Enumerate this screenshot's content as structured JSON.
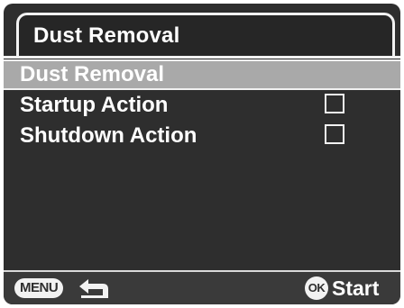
{
  "header": {
    "title": "Dust Removal"
  },
  "menu": {
    "items": [
      {
        "label": "Dust Removal",
        "selected": true,
        "has_checkbox": false
      },
      {
        "label": "Startup Action",
        "selected": false,
        "has_checkbox": true,
        "checked": false
      },
      {
        "label": "Shutdown Action",
        "selected": false,
        "has_checkbox": true,
        "checked": false
      }
    ]
  },
  "footer": {
    "menu_button_label": "MENU",
    "back_icon": "back-arrow-icon",
    "ok_button_label": "OK",
    "start_label": "Start"
  },
  "colors": {
    "background": "#2e2e2e",
    "highlight": "#a9a9a9",
    "text": "#ffffff"
  }
}
